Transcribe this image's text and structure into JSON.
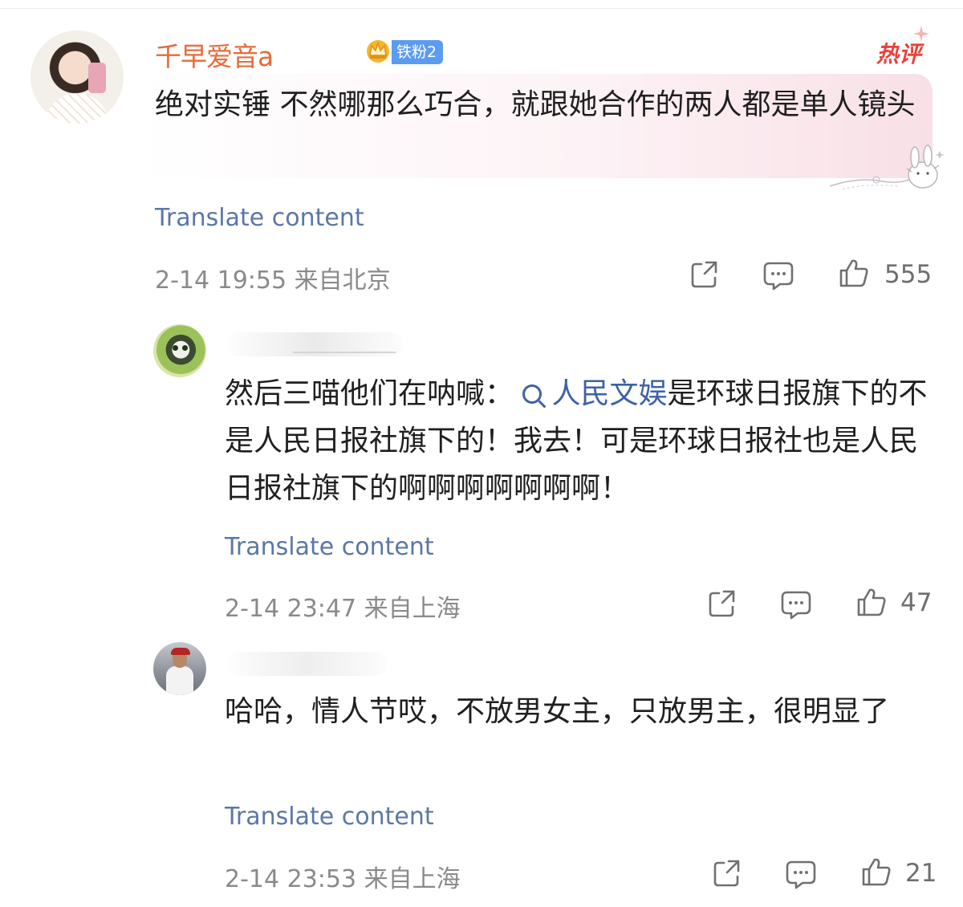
{
  "comments": [
    {
      "username": "千早爱音a",
      "fan_badge": "铁粉2",
      "hot_badge": "热评",
      "text": "绝对实锤 不然哪那么巧合，就跟她合作的两人都是单人镜头",
      "translate": "Translate content",
      "time": "2-14 19:55",
      "location": "来自北京",
      "likes": "555"
    },
    {
      "text_before": "然后三喵他们在呐喊：",
      "topic": "人民文娱",
      "text_after": "是环球日报旗下的不是人民日报社旗下的！我去！可是环球日报社也是人民日报社旗下的啊啊啊啊啊啊啊！",
      "translate": "Translate content",
      "time": "2-14 23:47",
      "location": "来自上海",
      "likes": "47"
    },
    {
      "text": "哈哈，情人节哎，不放男女主，只放男主，很明显了",
      "translate": "Translate content",
      "time": "2-14 23:53",
      "location": "来自上海",
      "likes": "21"
    }
  ],
  "icons": {
    "share": "share-icon",
    "comment": "comment-icon",
    "like": "thumbs-up-icon",
    "topic_search": "search-icon",
    "crown": "crown-icon"
  },
  "colors": {
    "username": "#e86a3a",
    "link": "#5b77a6",
    "topic": "#3d62a6",
    "hot": "#e8433b",
    "fan_badge": "#5b9cf0",
    "meta": "#8a8a8a"
  }
}
